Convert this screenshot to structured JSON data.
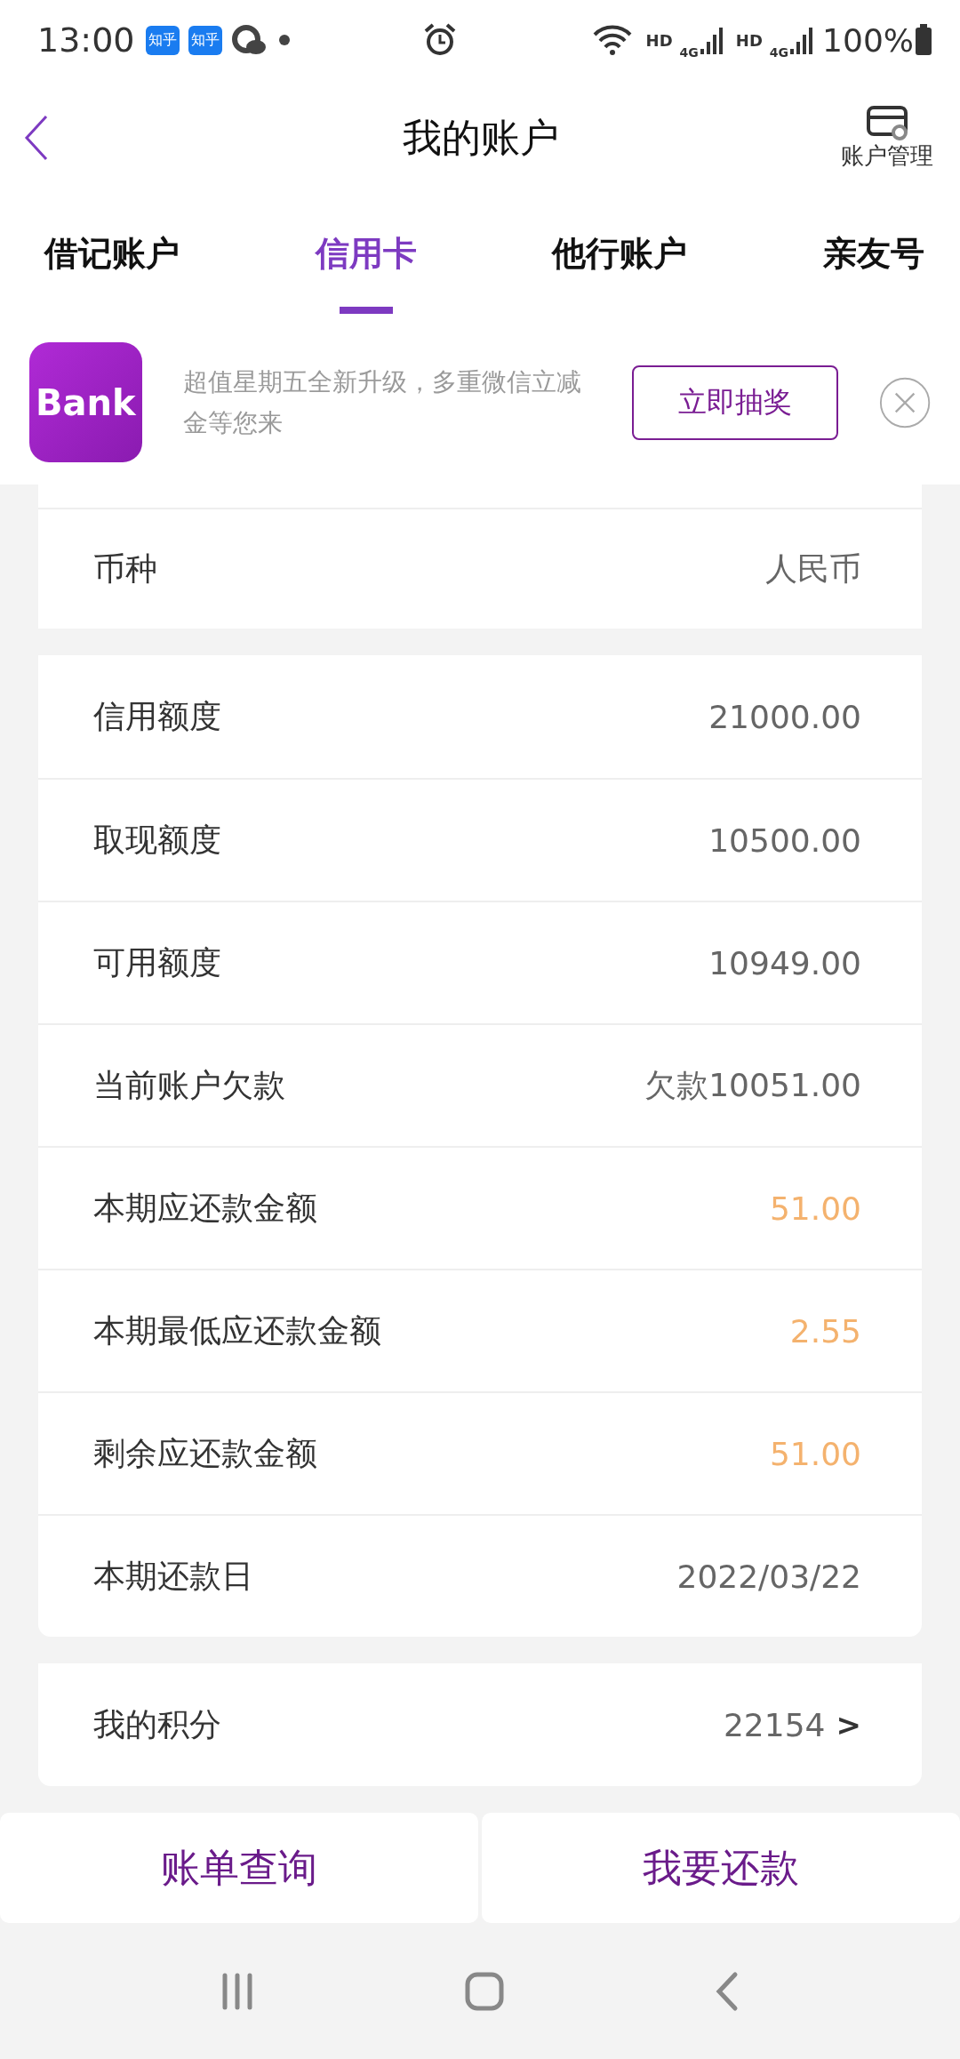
{
  "status_bar": {
    "time": "13:00",
    "app_badges": [
      "知乎",
      "知乎"
    ],
    "networks": [
      {
        "hd": "HD",
        "gen": "4G"
      },
      {
        "hd": "HD",
        "gen": "4G"
      }
    ],
    "battery": "100%"
  },
  "header": {
    "title": "我的账户",
    "action": "账户管理"
  },
  "tabs": [
    {
      "label": "借记账户",
      "selected": false
    },
    {
      "label": "信用卡",
      "selected": true
    },
    {
      "label": "他行账户",
      "selected": false
    },
    {
      "label": "亲友号",
      "selected": false
    }
  ],
  "banner": {
    "logo": "Bank",
    "text": "超值星期五全新升级，多重微信立减金等您来",
    "button": "立即抽奖"
  },
  "groups": [
    {
      "rows": [
        {
          "label": "币种",
          "value": "人民币",
          "emphasis": false
        }
      ]
    },
    {
      "rows": [
        {
          "label": "信用额度",
          "value": "21000.00",
          "emphasis": false
        },
        {
          "label": "取现额度",
          "value": "10500.00",
          "emphasis": false
        },
        {
          "label": "可用额度",
          "value": "10949.00",
          "emphasis": false
        },
        {
          "label": "当前账户欠款",
          "value": "欠款10051.00",
          "emphasis": false
        },
        {
          "label": "本期应还款金额",
          "value": "51.00",
          "emphasis": true
        },
        {
          "label": "本期最低应还款金额",
          "value": "2.55",
          "emphasis": true
        },
        {
          "label": "剩余应还款金额",
          "value": "51.00",
          "emphasis": true
        },
        {
          "label": "本期还款日",
          "value": "2022/03/22",
          "emphasis": false
        }
      ]
    },
    {
      "rows": [
        {
          "label": "我的积分",
          "value": "22154",
          "emphasis": false,
          "chevron": ">"
        }
      ]
    }
  ],
  "buttons": [
    "账单查询",
    "我要还款"
  ]
}
